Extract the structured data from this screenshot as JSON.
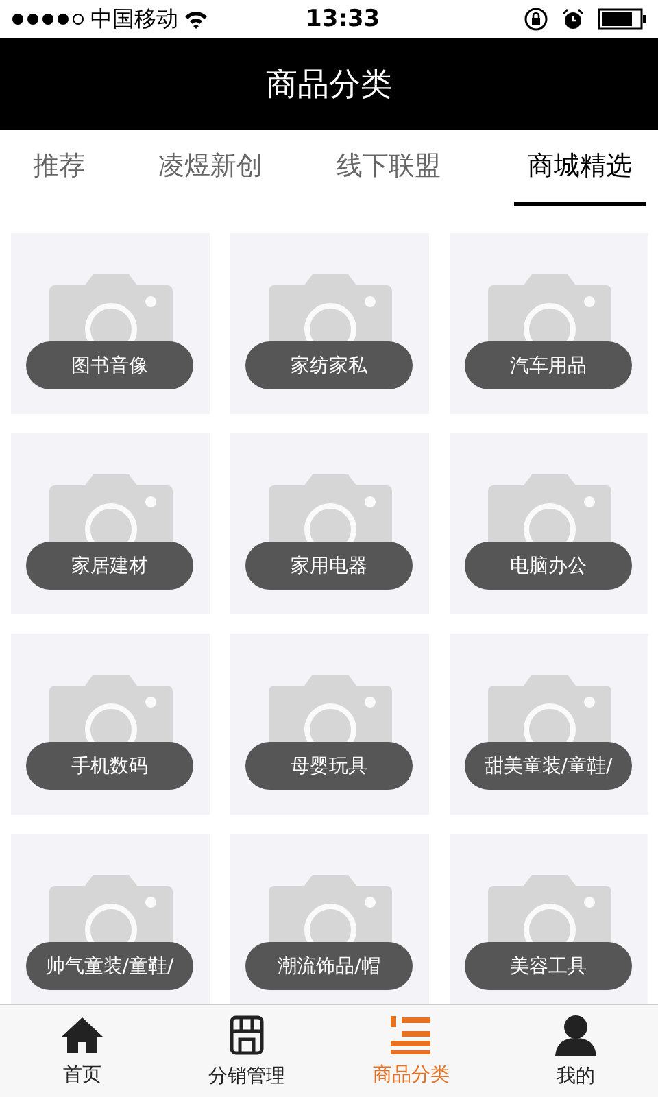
{
  "status_bar": {
    "carrier": "中国移动",
    "time": "13:33"
  },
  "header": {
    "title": "商品分类"
  },
  "tabs": [
    {
      "label": "推荐",
      "selected": false
    },
    {
      "label": "凌煜新创",
      "selected": false
    },
    {
      "label": "线下联盟",
      "selected": false
    },
    {
      "label": "商城精选",
      "selected": true
    }
  ],
  "categories": [
    {
      "label": "图书音像"
    },
    {
      "label": "家纺家私"
    },
    {
      "label": "汽车用品"
    },
    {
      "label": "家居建材"
    },
    {
      "label": "家用电器"
    },
    {
      "label": "电脑办公"
    },
    {
      "label": "手机数码"
    },
    {
      "label": "母婴玩具"
    },
    {
      "label": "甜美童装/童鞋/"
    },
    {
      "label": "帅气童装/童鞋/"
    },
    {
      "label": "潮流饰品/帽"
    },
    {
      "label": "美容工具"
    }
  ],
  "bottom_nav": [
    {
      "label": "首页",
      "kind": "home",
      "selected": false
    },
    {
      "label": "分销管理",
      "kind": "store",
      "selected": false
    },
    {
      "label": "商品分类",
      "kind": "list",
      "selected": true
    },
    {
      "label": "我的",
      "kind": "person",
      "selected": false
    }
  ]
}
